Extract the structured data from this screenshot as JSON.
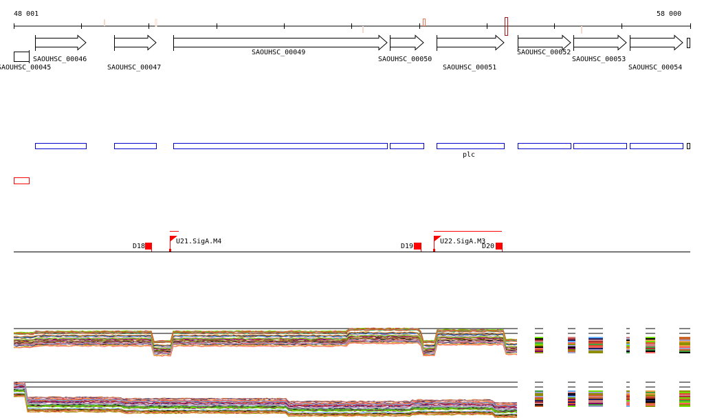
{
  "ruler": {
    "start_label": "48 001",
    "end_label": "58 000"
  },
  "genes": [
    {
      "name": "SAOUHSC_00045"
    },
    {
      "name": "SAOUHSC_00046"
    },
    {
      "name": "SAOUHSC_00047"
    },
    {
      "name": "SAOUHSC_00049"
    },
    {
      "name": "SAOUHSC_00050"
    },
    {
      "name": "SAOUHSC_00051"
    },
    {
      "name": "SAOUHSC_00052"
    },
    {
      "name": "SAOUHSC_00053"
    },
    {
      "name": "SAOUHSC_00054"
    }
  ],
  "cds_track": {
    "feature_label": "plc"
  },
  "regulatory": {
    "promoters": [
      {
        "name": "U21.SigA.M4"
      },
      {
        "name": "U22.SigA.M3"
      }
    ],
    "terminators": [
      {
        "name": "D18"
      },
      {
        "name": "D19"
      },
      {
        "name": "D20"
      }
    ]
  },
  "colors": {
    "gene_outline": "#000000",
    "cds_box": "#0000cc",
    "regulatory": "#ff0000",
    "mark_light": "#f8d8c8",
    "mark_orange": "#f07050",
    "mark_dark": "#b01010",
    "expression_series": [
      "#e05030",
      "#c86428",
      "#8c8c00",
      "#800060",
      "#66b0ff",
      "#70e000",
      "#202060",
      "#d08080",
      "#a0a0d0",
      "#e8a040",
      "#b03030",
      "#40a040",
      "#ff6060",
      "#909000",
      "#000000"
    ]
  }
}
